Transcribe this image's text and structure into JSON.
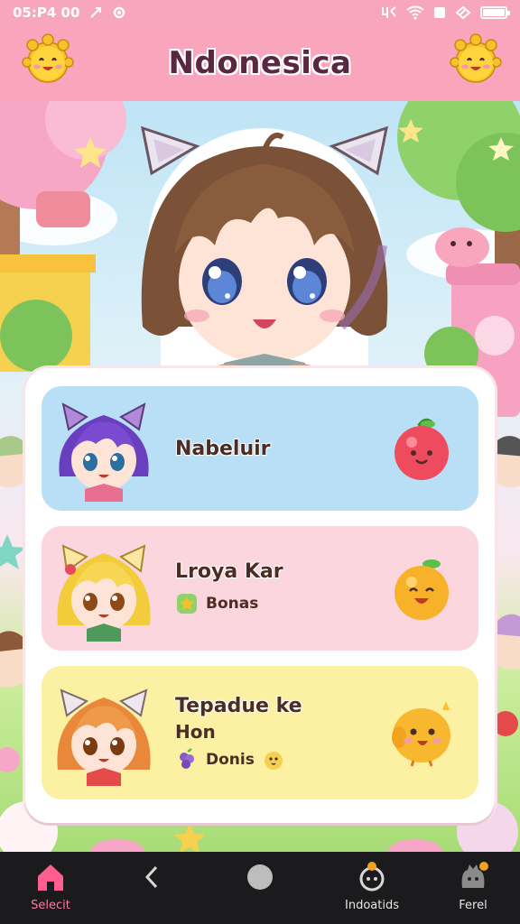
{
  "status_bar": {
    "time": "05:P4 00",
    "right_icons": [
      "usb-icon",
      "wifi-icon",
      "square-icon",
      "signal-icon",
      "battery-icon"
    ],
    "battery_level": 1.0
  },
  "header": {
    "title": "Ndonesica",
    "left_icon": "sun-mascot-icon",
    "right_icon": "sun-mascot-icon"
  },
  "cards": [
    {
      "title": "Nabeluir",
      "deco_icon": "apple-icon",
      "color": "#b9dff7"
    },
    {
      "title": "Lroya Kar",
      "tag_label": "Bonas",
      "tag_icon": "star-icon",
      "deco_icon": "orange-icon",
      "color": "#fbd6de"
    },
    {
      "title": "Tepadue ke",
      "subtitle": "Hon",
      "tag_label": "Donis",
      "tag_icon": "grape-icon",
      "deco_icon": "chick-icon",
      "color": "#fcf0a2"
    }
  ],
  "bottom_nav": {
    "items": [
      {
        "label": "Selecit",
        "icon": "home-icon",
        "active": true
      },
      {
        "label": "",
        "icon": "back-icon"
      },
      {
        "label": "",
        "icon": "circle-home-icon"
      },
      {
        "label": "Indoatids",
        "icon": "character-icon"
      },
      {
        "label": "Ferel",
        "icon": "cat-icon"
      }
    ]
  },
  "colors": {
    "accent_pink": "#f9a5bc",
    "nav_bg": "#1b1b1d",
    "active_nav": "#ff7aa1"
  }
}
